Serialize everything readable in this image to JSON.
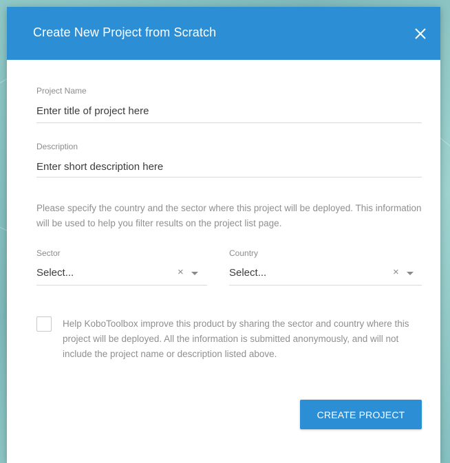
{
  "dialog": {
    "title": "Create New Project from Scratch",
    "close_icon": "close-icon"
  },
  "form": {
    "project_name": {
      "label": "Project Name",
      "placeholder": "Enter title of project here",
      "value": ""
    },
    "description": {
      "label": "Description",
      "placeholder": "Enter short description here",
      "value": ""
    },
    "help_text": "Please specify the country and the sector where this project will be deployed. This information will be used to help you filter results on the project list page.",
    "sector": {
      "label": "Sector",
      "value": "Select...",
      "clear_glyph": "×"
    },
    "country": {
      "label": "Country",
      "value": "Select...",
      "clear_glyph": "×"
    },
    "consent": {
      "checked": false,
      "text": "Help KoboToolbox improve this product by sharing the sector and country where this project will be deployed. All the information is submitted anonymously, and will not include the project name or description listed above."
    },
    "submit_label": "CREATE PROJECT"
  },
  "colors": {
    "accent": "#2c8fd6",
    "label": "#8c8c8c",
    "text": "#3b3b3b",
    "background": "#8fc8c6"
  }
}
